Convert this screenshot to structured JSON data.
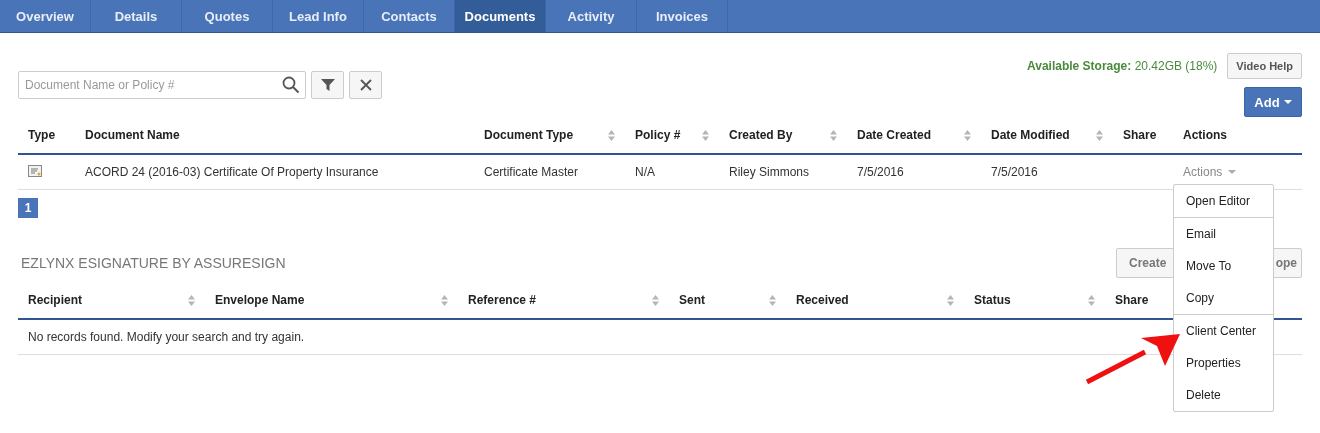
{
  "tabs": [
    {
      "label": "Overview",
      "selected": false
    },
    {
      "label": "Details",
      "selected": false
    },
    {
      "label": "Quotes",
      "selected": false
    },
    {
      "label": "Lead Info",
      "selected": false
    },
    {
      "label": "Contacts",
      "selected": false
    },
    {
      "label": "Documents",
      "selected": true
    },
    {
      "label": "Activity",
      "selected": false
    },
    {
      "label": "Invoices",
      "selected": false
    }
  ],
  "storage": {
    "label": "Available Storage:",
    "value": "20.42GB (18%)"
  },
  "video_help": "Video Help",
  "add_button": "Add",
  "search": {
    "placeholder": "Document Name or Policy #"
  },
  "documents": {
    "columns": [
      {
        "label": "Type",
        "sortable": false
      },
      {
        "label": "Document Name",
        "sortable": false
      },
      {
        "label": "Document Type",
        "sortable": true
      },
      {
        "label": "Policy #",
        "sortable": true
      },
      {
        "label": "Created By",
        "sortable": true
      },
      {
        "label": "Date Created",
        "sortable": true
      },
      {
        "label": "Date Modified",
        "sortable": true
      },
      {
        "label": "Share",
        "sortable": false
      },
      {
        "label": "Actions",
        "sortable": false
      }
    ],
    "rows": [
      {
        "name": "ACORD 24 (2016-03) Certificate Of Property Insurance",
        "document_type": "Certificate Master",
        "policy": "N/A",
        "created_by": "Riley Simmons",
        "date_created": "7/5/2016",
        "date_modified": "7/5/2016",
        "actions": "Actions"
      }
    ],
    "pages": [
      {
        "label": "1",
        "selected": true
      }
    ]
  },
  "esignature": {
    "title": "EZLYNX ESIGNATURE BY ASSURESIGN",
    "create_button": {
      "label_start": "Create",
      "label_end": "ope"
    },
    "columns": [
      {
        "label": "Recipient",
        "sortable": true
      },
      {
        "label": "Envelope Name",
        "sortable": true
      },
      {
        "label": "Reference #",
        "sortable": true
      },
      {
        "label": "Sent",
        "sortable": true
      },
      {
        "label": "Received",
        "sortable": true
      },
      {
        "label": "Status",
        "sortable": true
      },
      {
        "label": "Share",
        "sortable": false
      }
    ],
    "empty_message": "No records found. Modify your search and try again."
  },
  "actions_menu": {
    "sections": [
      [
        "Open Editor"
      ],
      [
        "Email",
        "Move To",
        "Copy"
      ],
      [
        "Client Center",
        "Properties",
        "Delete"
      ]
    ]
  }
}
